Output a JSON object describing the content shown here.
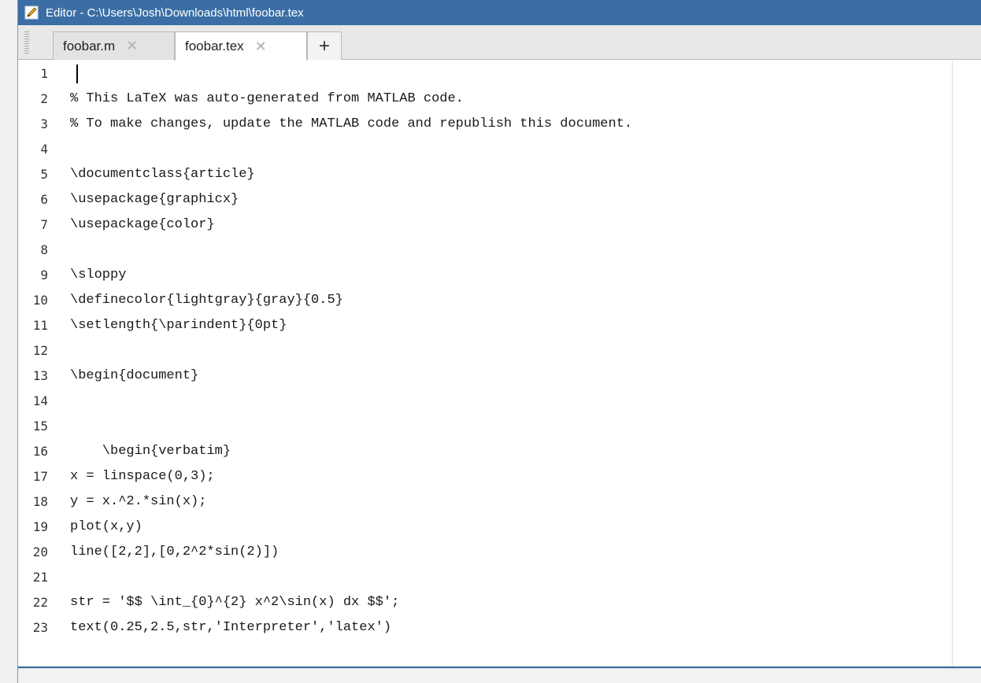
{
  "window": {
    "title": "Editor - C:\\Users\\Josh\\Downloads\\html\\foobar.tex",
    "icon": "pencil-editor-icon"
  },
  "tabs": [
    {
      "label": "foobar.m",
      "close": "✕",
      "active": false
    },
    {
      "label": "foobar.tex",
      "close": "✕",
      "active": true
    }
  ],
  "add_tab_label": "+",
  "editor": {
    "lines": [
      {
        "num": "1",
        "text": ""
      },
      {
        "num": "2",
        "text": "% This LaTeX was auto-generated from MATLAB code."
      },
      {
        "num": "3",
        "text": "% To make changes, update the MATLAB code and republish this document."
      },
      {
        "num": "4",
        "text": ""
      },
      {
        "num": "5",
        "text": "\\documentclass{article}"
      },
      {
        "num": "6",
        "text": "\\usepackage{graphicx}"
      },
      {
        "num": "7",
        "text": "\\usepackage{color}"
      },
      {
        "num": "8",
        "text": ""
      },
      {
        "num": "9",
        "text": "\\sloppy"
      },
      {
        "num": "10",
        "text": "\\definecolor{lightgray}{gray}{0.5}"
      },
      {
        "num": "11",
        "text": "\\setlength{\\parindent}{0pt}"
      },
      {
        "num": "12",
        "text": ""
      },
      {
        "num": "13",
        "text": "\\begin{document}"
      },
      {
        "num": "14",
        "text": ""
      },
      {
        "num": "15",
        "text": ""
      },
      {
        "num": "16",
        "text": "    \\begin{verbatim}"
      },
      {
        "num": "17",
        "text": "x = linspace(0,3);"
      },
      {
        "num": "18",
        "text": "y = x.^2.*sin(x);"
      },
      {
        "num": "19",
        "text": "plot(x,y)"
      },
      {
        "num": "20",
        "text": "line([2,2],[0,2^2*sin(2)])"
      },
      {
        "num": "21",
        "text": ""
      },
      {
        "num": "22",
        "text": "str = '$$ \\int_{0}^{2} x^2\\sin(x) dx $$';"
      },
      {
        "num": "23",
        "text": "text(0.25,2.5,str,'Interpreter','latex')"
      }
    ]
  },
  "colors": {
    "title_bar": "#3a6ea5",
    "title_text": "#ffffff",
    "border_accent": "#3a6ea5"
  }
}
